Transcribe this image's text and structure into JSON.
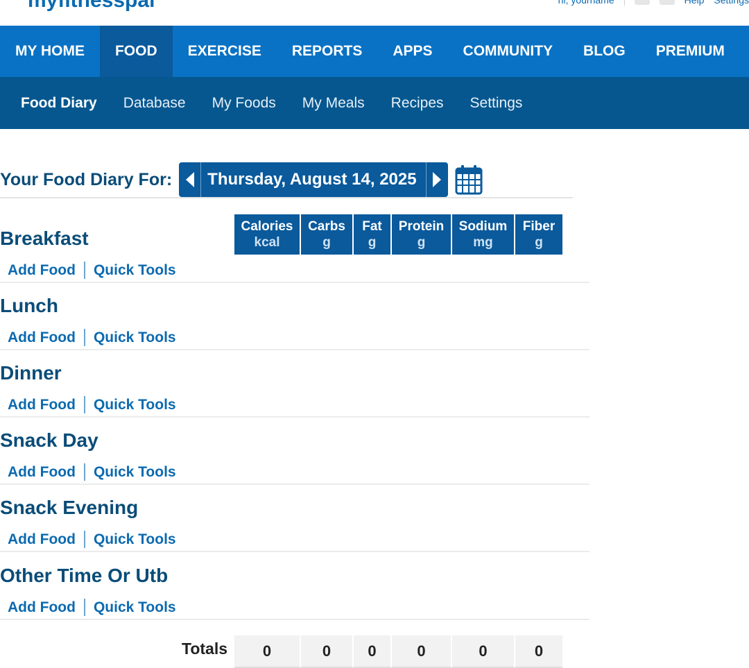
{
  "brand": {
    "logo_text": "myfitnesspal"
  },
  "top_links": {
    "user": "hi, yourname",
    "help": "Help",
    "settings": "Settings"
  },
  "main_nav": [
    {
      "label": "MY HOME",
      "active": false
    },
    {
      "label": "FOOD",
      "active": true
    },
    {
      "label": "EXERCISE",
      "active": false
    },
    {
      "label": "REPORTS",
      "active": false
    },
    {
      "label": "APPS",
      "active": false
    },
    {
      "label": "COMMUNITY",
      "active": false
    },
    {
      "label": "BLOG",
      "active": false
    },
    {
      "label": "PREMIUM",
      "active": false
    }
  ],
  "sub_nav": [
    {
      "label": "Food Diary",
      "active": true
    },
    {
      "label": "Database",
      "active": false
    },
    {
      "label": "My Foods",
      "active": false
    },
    {
      "label": "My Meals",
      "active": false
    },
    {
      "label": "Recipes",
      "active": false
    },
    {
      "label": "Settings",
      "active": false
    }
  ],
  "diary": {
    "label": "Your Food Diary For:",
    "date": "Thursday, August 14, 2025"
  },
  "columns": [
    {
      "name": "Calories",
      "unit": "kcal"
    },
    {
      "name": "Carbs",
      "unit": "g"
    },
    {
      "name": "Fat",
      "unit": "g"
    },
    {
      "name": "Protein",
      "unit": "g"
    },
    {
      "name": "Sodium",
      "unit": "mg"
    },
    {
      "name": "Fiber",
      "unit": "g"
    }
  ],
  "meals": [
    {
      "name": "Breakfast",
      "add_food": "Add Food",
      "quick_tools": "Quick Tools"
    },
    {
      "name": "Lunch",
      "add_food": "Add Food",
      "quick_tools": "Quick Tools"
    },
    {
      "name": "Dinner",
      "add_food": "Add Food",
      "quick_tools": "Quick Tools"
    },
    {
      "name": "Snack Day",
      "add_food": "Add Food",
      "quick_tools": "Quick Tools"
    },
    {
      "name": "Snack Evening",
      "add_food": "Add Food",
      "quick_tools": "Quick Tools"
    },
    {
      "name": "Other Time Or Utb",
      "add_food": "Add Food",
      "quick_tools": "Quick Tools"
    }
  ],
  "totals": {
    "label": "Totals",
    "values": [
      "0",
      "0",
      "0",
      "0",
      "0",
      "0"
    ]
  },
  "colors": {
    "nav_blue": "#0a72c4",
    "nav_active": "#0a5a9c",
    "subnav_blue": "#06578f",
    "link_blue": "#0b6ab0",
    "heading_blue": "#0a4c78"
  }
}
